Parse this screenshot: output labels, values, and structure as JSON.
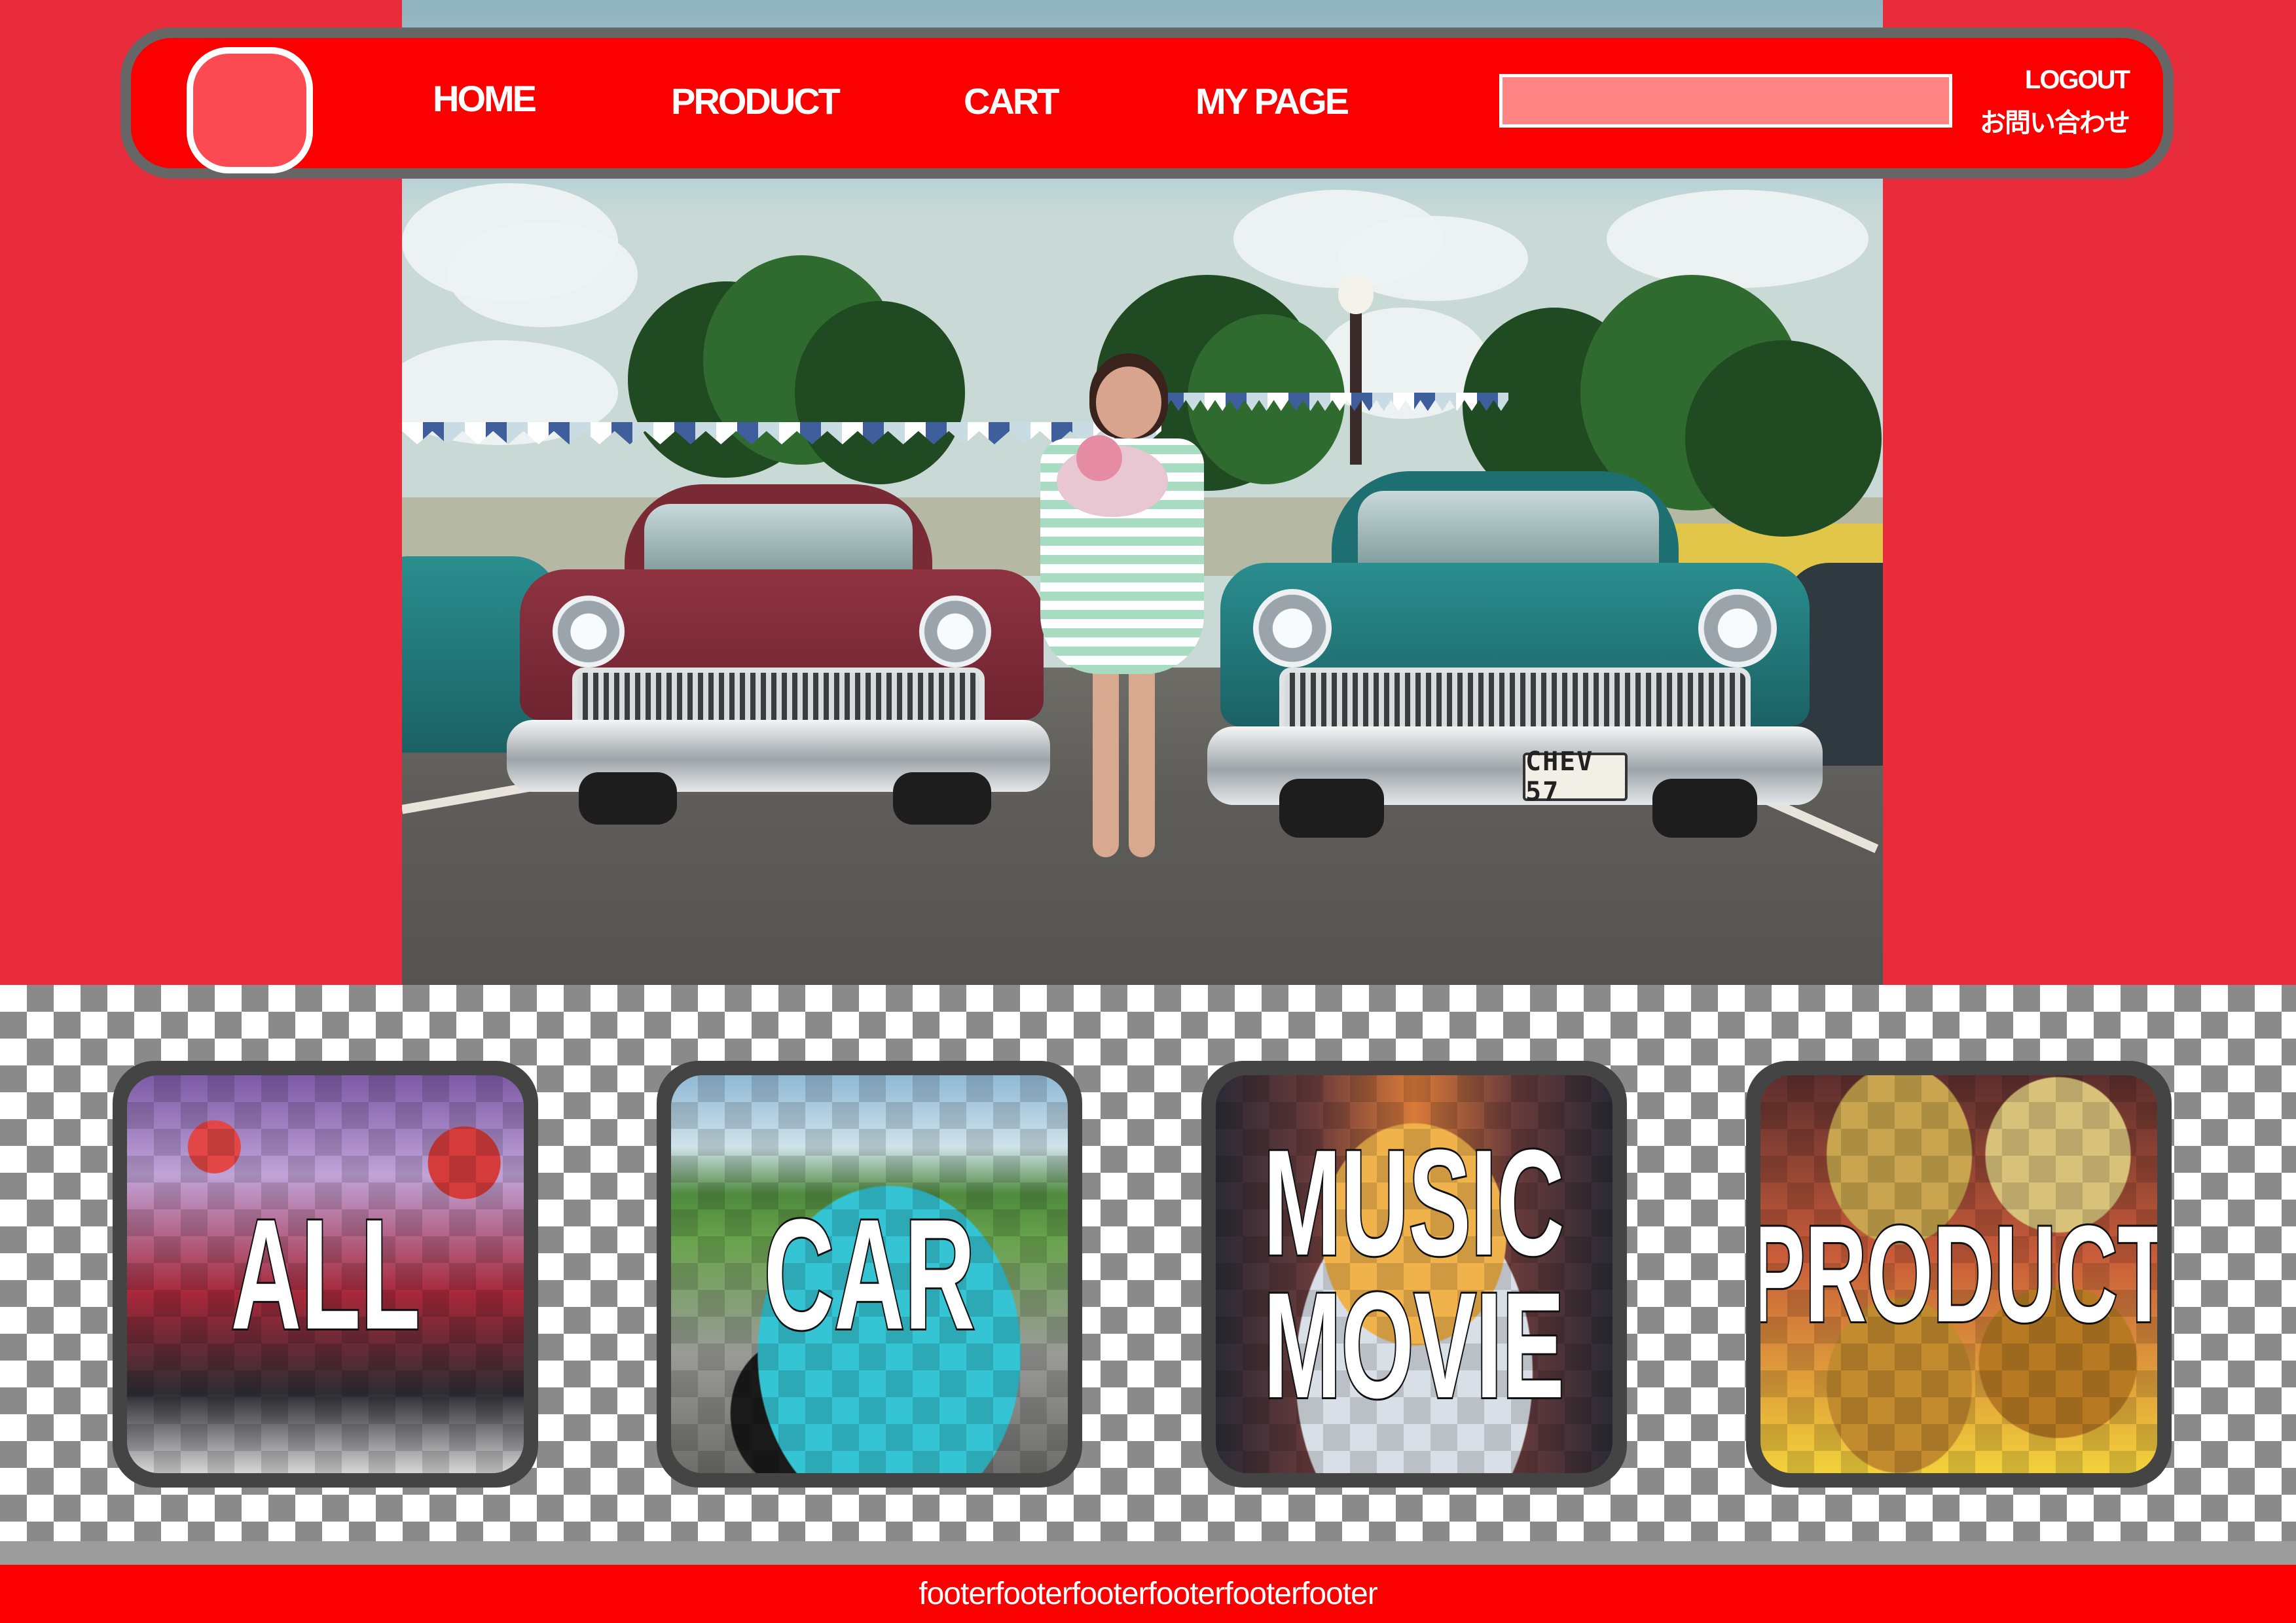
{
  "header": {
    "logo_alt": "",
    "nav": [
      {
        "label": "HOME"
      },
      {
        "label": "PRODUCT"
      },
      {
        "label": "CART"
      },
      {
        "label": "MY PAGE"
      }
    ],
    "search": {
      "placeholder": "",
      "value": ""
    },
    "logout_label": "LOGOUT",
    "contact_label": "お問い合わせ"
  },
  "hero": {
    "plate_text": "CHEV 57"
  },
  "categories": [
    {
      "label_lines": [
        "ALL"
      ]
    },
    {
      "label_lines": [
        "CAR"
      ]
    },
    {
      "label_lines": [
        "MUSIC",
        "MOVIE"
      ]
    },
    {
      "label_lines": [
        "PRODUCT"
      ]
    }
  ],
  "footer": {
    "text": "footerfooterfooterfooterfooterfooter"
  },
  "colors": {
    "page_bg": "#e92c3c",
    "nav_bg": "#fb0000",
    "nav_border": "#666666",
    "logo_fill": "#fb4a52",
    "search_fill": "#ff8585",
    "card_frame": "#444444",
    "footer_bg": "#fb0000"
  },
  "icons": {
    "logo": "rounded-square-logo"
  }
}
